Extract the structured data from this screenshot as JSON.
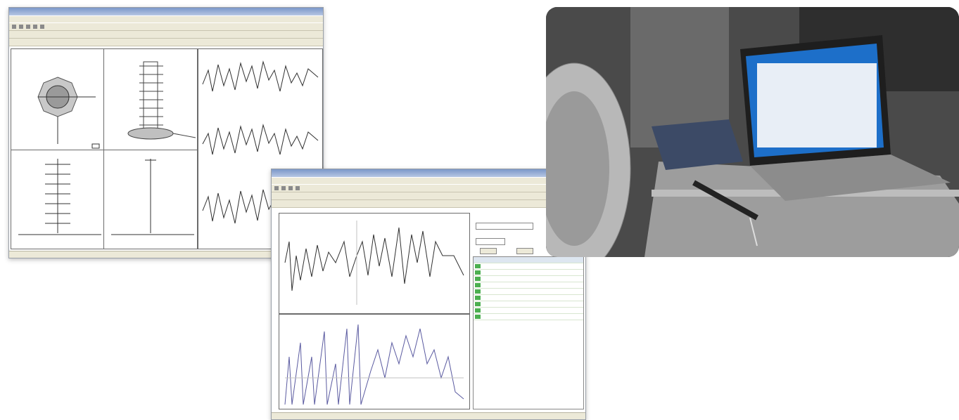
{
  "screens": {
    "structure_window": {
      "panels": [
        "top-view",
        "3d-view",
        "front-view",
        "side-view",
        "waveform-stack"
      ]
    },
    "analysis_window": {
      "panels": [
        "time-waveform",
        "spectrum",
        "results-table"
      ]
    }
  },
  "photo": {
    "subject": "laptop-measurement-setup"
  },
  "colors": {
    "window_chrome": "#ece9d8",
    "titlebar": "#7b97c9",
    "wave": "#303030",
    "spectrum": "#5a5aa0",
    "table_green": "#4caf50"
  }
}
